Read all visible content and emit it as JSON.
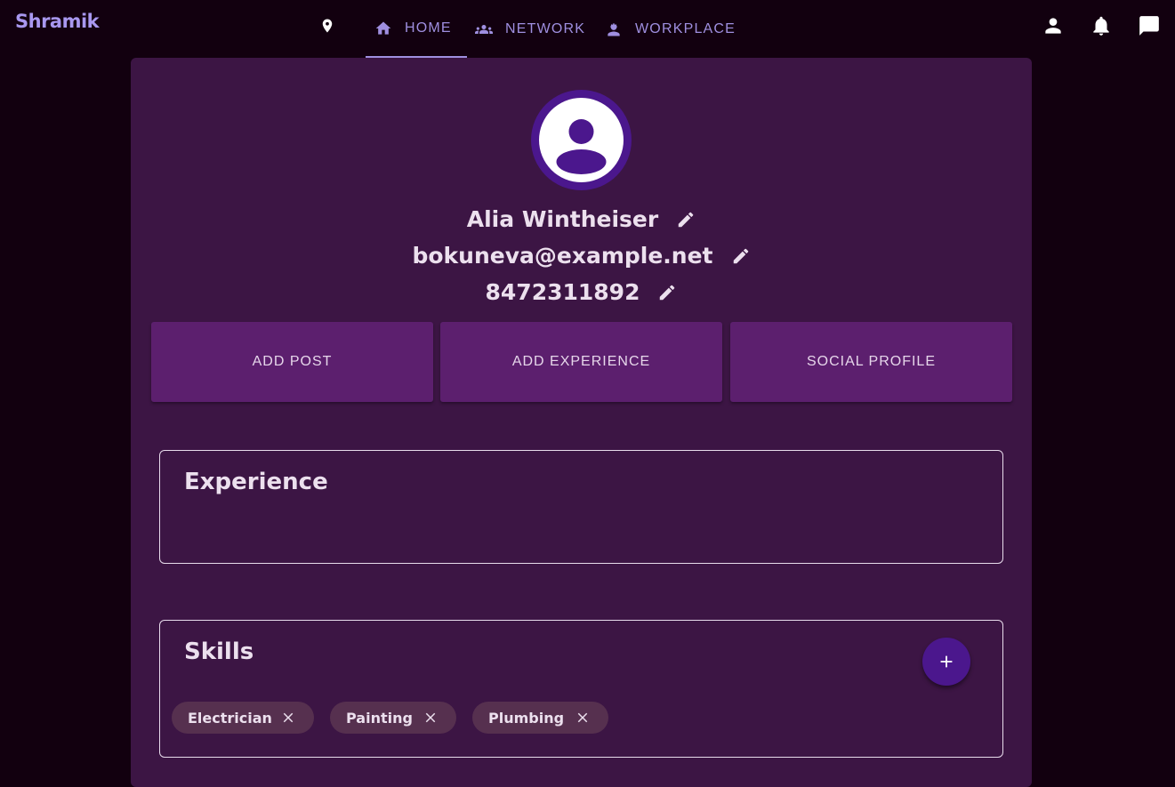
{
  "brand": "Shramik",
  "nav": {
    "tabs": [
      {
        "label": "HOME",
        "icon": "home-icon",
        "active": true
      },
      {
        "label": "NETWORK",
        "icon": "people-icon",
        "active": false
      },
      {
        "label": "WORKPLACE",
        "icon": "worker-icon",
        "active": false
      }
    ],
    "location_icon": "location-pin-icon",
    "right_icons": [
      "account-icon",
      "bell-icon",
      "chat-icon"
    ]
  },
  "profile": {
    "name": "Alia Wintheiser",
    "email": "bokuneva@example.net",
    "phone": "8472311892",
    "avatar_icon": "account-circle-icon"
  },
  "actions": {
    "add_post": "ADD POST",
    "add_experience": "ADD EXPERIENCE",
    "social_profile": "SOCIAL PROFILE"
  },
  "experience": {
    "title": "Experience"
  },
  "skills": {
    "title": "Skills",
    "items": [
      "Electrician",
      "Painting",
      "Plumbing"
    ]
  },
  "colors": {
    "page_bg": "#12000f",
    "card_bg": "#3c1544",
    "accent": "#9f8fe0",
    "button_bg": "#5c1f6e",
    "avatar_ring": "#4b178d",
    "chip_bg": "#56304f"
  }
}
